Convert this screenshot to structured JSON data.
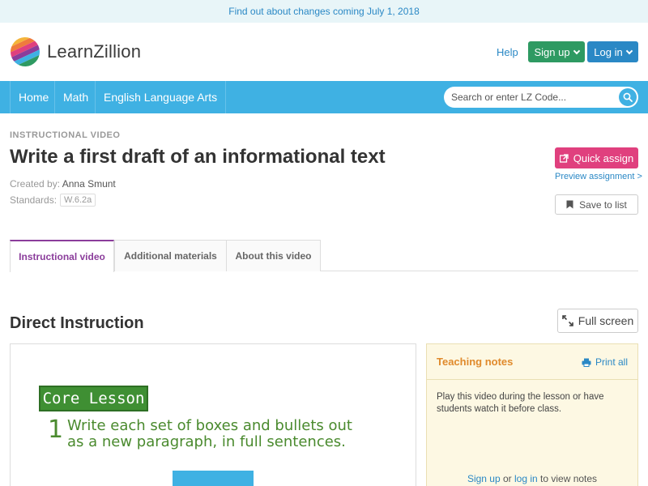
{
  "announcement": "Find out about changes coming July 1, 2018",
  "brand": {
    "name": "LearnZillion"
  },
  "header": {
    "help": "Help",
    "signup": "Sign up",
    "login": "Log in"
  },
  "nav": {
    "items": [
      "Home",
      "Math",
      "English Language Arts"
    ],
    "search_placeholder": "Search or enter LZ Code..."
  },
  "lesson": {
    "kicker": "INSTRUCTIONAL VIDEO",
    "title": "Write a first draft of an informational text",
    "created_by_label": "Created by:",
    "author": "Anna Smunt",
    "standards_label": "Standards:",
    "standard": "W.6.2a"
  },
  "actions": {
    "quick_assign": "Quick assign",
    "preview": "Preview assignment >",
    "save": "Save to list"
  },
  "tabs": [
    {
      "label": "Instructional video",
      "active": true
    },
    {
      "label": "Additional materials",
      "active": false
    },
    {
      "label": "About this video",
      "active": false
    }
  ],
  "section": {
    "title": "Direct Instruction",
    "full_screen": "Full screen"
  },
  "video": {
    "core_label": "Core Lesson",
    "step_number": "1",
    "step_text": "Write each set of boxes and bullets out as a new paragraph, in full sentences."
  },
  "notes": {
    "title": "Teaching notes",
    "print": "Print all",
    "body": "Play this video during the lesson or have students watch it before class.",
    "footer_signup": "Sign up",
    "footer_or": " or ",
    "footer_login": "log in",
    "footer_rest": " to view notes"
  },
  "colors": {
    "nav_blue": "#3fb1e3",
    "signup_green": "#2e9a62",
    "login_blue": "#2a88c5",
    "quick_assign_pink": "#e0407e",
    "tab_active_purple": "#8b3d9b",
    "notes_title_orange": "#e08a2c"
  },
  "icons": {
    "logo": "striped-circle-logo",
    "search": "search-icon",
    "quick_assign": "external-square-icon",
    "save": "bookmark-icon",
    "full_screen": "expand-icon",
    "print": "printer-icon"
  }
}
